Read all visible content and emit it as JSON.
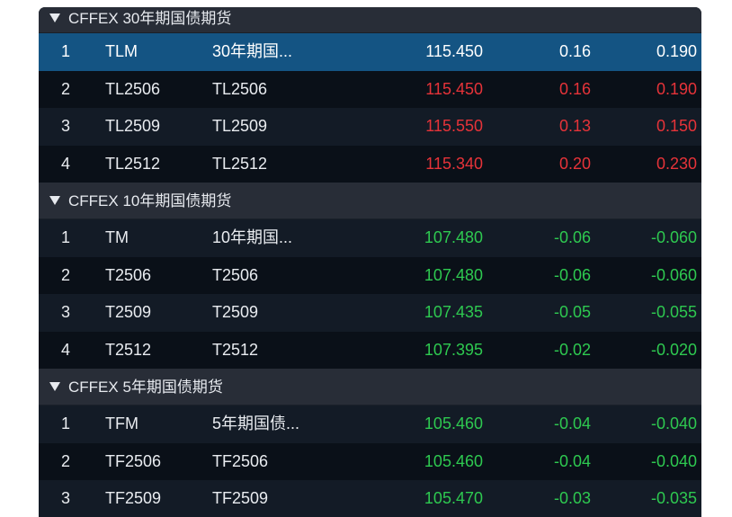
{
  "colors": {
    "up": "#e63339",
    "down": "#2ec950",
    "selected_row": "#145483"
  },
  "icons": {
    "group_toggle": "caret-down-icon"
  },
  "groups": [
    {
      "title": "CFFEX 30年期国债期货",
      "expanded": true,
      "rows": [
        {
          "idx": "1",
          "code": "TLM",
          "name": "30年期国...",
          "price": "115.450",
          "change": "0.16",
          "change_2": "0.190",
          "selected": true
        },
        {
          "idx": "2",
          "code": "TL2506",
          "name": "TL2506",
          "price": "115.450",
          "change": "0.16",
          "change_2": "0.190"
        },
        {
          "idx": "3",
          "code": "TL2509",
          "name": "TL2509",
          "price": "115.550",
          "change": "0.13",
          "change_2": "0.150"
        },
        {
          "idx": "4",
          "code": "TL2512",
          "name": "TL2512",
          "price": "115.340",
          "change": "0.20",
          "change_2": "0.230"
        }
      ]
    },
    {
      "title": "CFFEX 10年期国债期货",
      "expanded": true,
      "rows": [
        {
          "idx": "1",
          "code": "TM",
          "name": "10年期国...",
          "price": "107.480",
          "change": "-0.06",
          "change_2": "-0.060"
        },
        {
          "idx": "2",
          "code": "T2506",
          "name": "T2506",
          "price": "107.480",
          "change": "-0.06",
          "change_2": "-0.060"
        },
        {
          "idx": "3",
          "code": "T2509",
          "name": "T2509",
          "price": "107.435",
          "change": "-0.05",
          "change_2": "-0.055"
        },
        {
          "idx": "4",
          "code": "T2512",
          "name": "T2512",
          "price": "107.395",
          "change": "-0.02",
          "change_2": "-0.020"
        }
      ]
    },
    {
      "title": "CFFEX 5年期国债期货",
      "expanded": true,
      "rows": [
        {
          "idx": "1",
          "code": "TFM",
          "name": "5年期国债...",
          "price": "105.460",
          "change": "-0.04",
          "change_2": "-0.040"
        },
        {
          "idx": "2",
          "code": "TF2506",
          "name": "TF2506",
          "price": "105.460",
          "change": "-0.04",
          "change_2": "-0.040"
        },
        {
          "idx": "3",
          "code": "TF2509",
          "name": "TF2509",
          "price": "105.470",
          "change": "-0.03",
          "change_2": "-0.035"
        }
      ]
    }
  ]
}
